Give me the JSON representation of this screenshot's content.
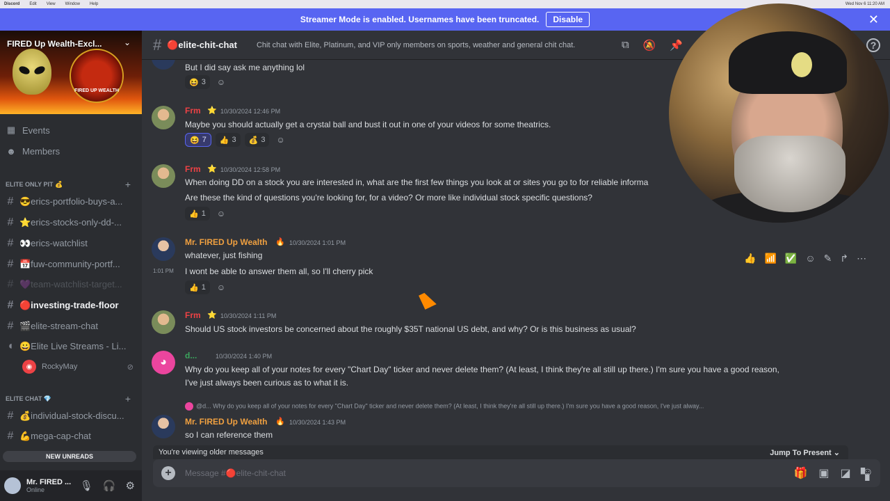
{
  "macbar": {
    "app": "Discord",
    "menus": [
      "Edit",
      "View",
      "Window",
      "Help"
    ],
    "clock": "Wed Nov 6 11:20 AM"
  },
  "banner": {
    "text": "Streamer Mode is enabled. Usernames have been truncated.",
    "disable_label": "Disable",
    "close_icon": "close-icon"
  },
  "server": {
    "name": "FIRED Up Wealth-Excl...",
    "badge_text": "FIRED UP WEALTH"
  },
  "sidebar": {
    "nav": [
      {
        "label": "Events",
        "icon": "calendar-icon"
      },
      {
        "label": "Members",
        "icon": "members-icon"
      }
    ],
    "category1": "ELITE ONLY PIT 💰",
    "channels1": [
      {
        "label": "😎erics-portfolio-buys-a..."
      },
      {
        "label": "⭐erics-stocks-only-dd-..."
      },
      {
        "label": "👀erics-watchlist"
      },
      {
        "label": "📅fuw-community-portf..."
      },
      {
        "label": "💜team-watchlist-target..."
      },
      {
        "label": "🔴investing-trade-floor"
      },
      {
        "label": "🎬elite-stream-chat"
      },
      {
        "label": "😀Elite Live Streams - Li..."
      }
    ],
    "voice_user": "RockyMay",
    "category2": "ELITE CHAT 💎",
    "channels2": [
      {
        "label": "💰individual-stock-discu..."
      },
      {
        "label": "💪mega-cap-chat"
      }
    ],
    "new_unreads": "NEW UNREADS",
    "user": {
      "name": "Mr. FIRED ...",
      "status": "Online"
    }
  },
  "header": {
    "channel": "🔴elite-chit-chat",
    "topic": "Chit chat with Elite, Platinum, and VIP only members on sports, weather and general chit chat."
  },
  "messages": [
    {
      "text": "But I did say ask me anything lol",
      "reactions": [
        {
          "emoji": "😆",
          "count": "3"
        }
      ]
    },
    {
      "author": "Frm",
      "time": "10/30/2024 12:46 PM",
      "text": "Maybe you should actually get a crystal ball and bust it out in one of your videos for some theatrics.",
      "reactions": [
        {
          "emoji": "😆",
          "count": "7"
        },
        {
          "emoji": "👍",
          "count": "3"
        },
        {
          "emoji": "💰",
          "count": "3"
        }
      ]
    },
    {
      "author": "Frm",
      "time": "10/30/2024 12:58 PM",
      "text": "When doing DD on a stock you are interested in, what are the first few things you look at or sites you go to for reliable informa",
      "text2": "Are these the kind of questions you're looking for, for a video?  Or more like individual stock specific questions?",
      "reactions": [
        {
          "emoji": "👍",
          "count": "1"
        }
      ]
    },
    {
      "author": "Mr. FIRED Up Wealth",
      "time": "10/30/2024 1:01 PM",
      "text": "whatever, just fishing",
      "side_time": "1:01 PM",
      "text2": "I wont be able to answer them all, so I'll cherry pick",
      "reactions": [
        {
          "emoji": "👍",
          "count": "1"
        }
      ]
    },
    {
      "author": "Frm",
      "time": "10/30/2024 1:11 PM",
      "text": "Should US stock investors be concerned about the roughly $35T national US debt, and why? Or is this business as usual?"
    },
    {
      "author": "d...",
      "time": "10/30/2024 1:40 PM",
      "text": "Why do you keep all of your notes for every \"Chart Day\" ticker and never delete them? (At least, I think they're all still up there.) I'm sure you have a good reason,",
      "text2": "I've just always been curious as to what it is."
    },
    {
      "reply": "@d... Why do you keep all of your notes for every \"Chart Day\" ticker and never delete them? (At least, I think they're all still up there.) I'm sure you have a good reason, I've just alway...",
      "author": "Mr. FIRED Up Wealth",
      "time": "10/30/2024 1:43 PM",
      "text": "so I can reference them"
    }
  ],
  "composer": {
    "older_text": "You're viewing older messages",
    "jump_label": "Jump To Present",
    "placeholder": "Message #🔴elite-chit-chat"
  },
  "colors": {
    "blurple": "#5865f2",
    "author_orange": "#f0a040",
    "author_red": "#ed4245",
    "bg": "#313338"
  }
}
